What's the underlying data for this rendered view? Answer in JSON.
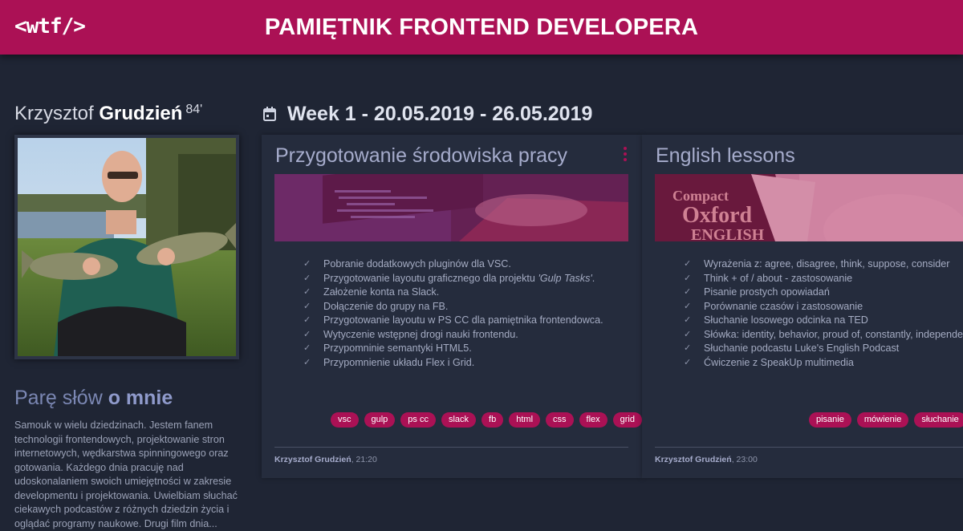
{
  "header": {
    "logo": "<wtf/>",
    "title": "PAMIĘTNIK FRONTEND DEVELOPERA"
  },
  "profile": {
    "first_name": "Krzysztof",
    "last_name": "Grudzień",
    "year": "84'",
    "about_title_light": "Parę słów",
    "about_title_bold": "o mnie",
    "about_text": "Samouk w wielu dziedzinach. Jestem fanem technologii frontendowych, projektowanie stron internetowych, wędkarstwa spinningowego oraz gotowania. Każdego dnia pracuję nad udoskonalaniem swoich umiejętności w zakresie developmentu i projektowania. Uwielbiam słuchać ciekawych podcastów z różnych dziedzin życia i oglądać programy naukowe. Drugi film dnia..."
  },
  "week": {
    "label": "Week 1 - 20.05.2019 - 26.05.2019",
    "icon": "calendar-icon"
  },
  "cards": [
    {
      "title": "Przygotowanie środowiska pracy",
      "tasks": [
        "Pobranie dodatkowych pluginów dla VSC.",
        "Przygotowanie layoutu graficznego dla projektu ",
        "Założenie konta na Slack.",
        "Dołączenie do grupy na FB.",
        "Przygotowanie layoutu w PS CC dla pamiętnika frontendowca.",
        "Wytyczenie wstępnej drogi nauki frontendu.",
        "Przypomninie semantyki HTML5.",
        "Przypomnienie układu Flex i Grid."
      ],
      "task2_italic": "'Gulp Tasks'",
      "task2_suffix": ".",
      "tags": [
        "vsc",
        "gulp",
        "ps cc",
        "slack",
        "fb",
        "html",
        "css",
        "flex",
        "grid"
      ],
      "author": "Krzysztof Grudzień",
      "time": ", 21:20"
    },
    {
      "title": "English lessons",
      "tasks": [
        "Wyrażenia z: agree, disagree, think, suppose, consider",
        "Think + of / about - zastosowanie",
        "Pisanie prostych opowiadań",
        "Porównanie czasów i zastosowanie",
        "Słuchanie losowego odcinka na TED",
        "Słówka: identity, behavior, proud of, constantly, independence",
        "Słuchanie podcastu Luke's English Podcast",
        "Ćwiczenie z SpeakUp multimedia"
      ],
      "tags": [
        "pisanie",
        "mówienie",
        "słuchanie"
      ],
      "author": "Krzysztof Grudzień",
      "time": ", 23:00",
      "banner_book": {
        "line1": "Compact",
        "line2": "Oxford",
        "line3": "ENGLISH"
      }
    }
  ],
  "colors": {
    "accent": "#ab1155",
    "background": "#1f2534",
    "card": "#252c3d"
  }
}
